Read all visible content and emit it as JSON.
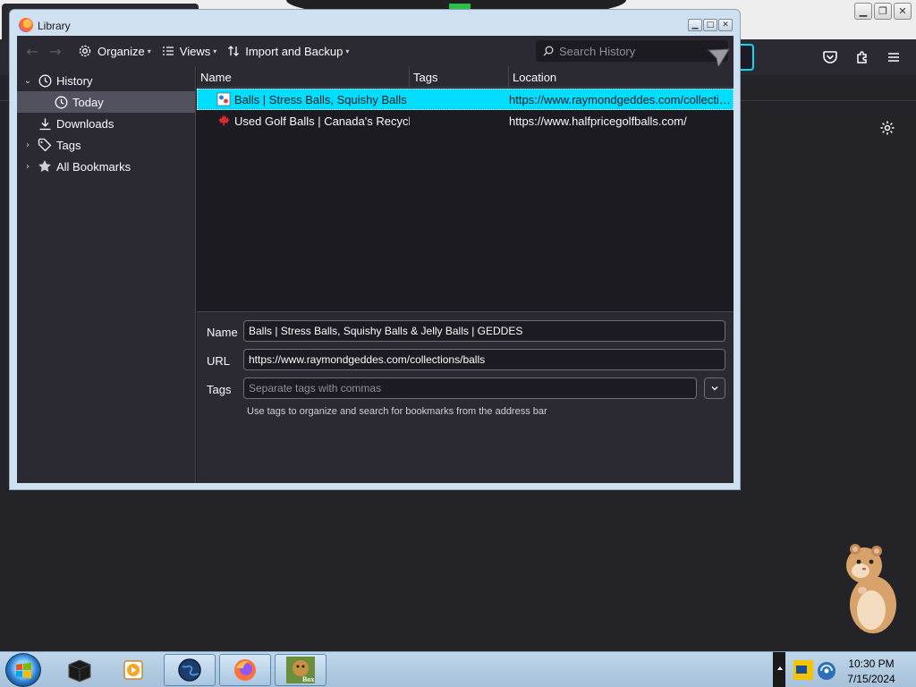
{
  "window": {
    "title": "Library"
  },
  "toolbar": {
    "back_icon": "back-arrow-icon",
    "forward_icon": "forward-arrow-icon",
    "organize_label": "Organize",
    "views_label": "Views",
    "import_label": "Import and Backup",
    "search_placeholder": "Search History"
  },
  "sidebar": {
    "items": [
      {
        "label": "History",
        "icon": "clock-icon",
        "expanded": true
      },
      {
        "label": "Today",
        "icon": "clock-icon",
        "selected": true
      },
      {
        "label": "Downloads",
        "icon": "download-icon"
      },
      {
        "label": "Tags",
        "icon": "tag-icon",
        "expanded": false
      },
      {
        "label": "All Bookmarks",
        "icon": "star-icon",
        "expanded": false
      }
    ]
  },
  "columns": {
    "name": "Name",
    "tags": "Tags",
    "location": "Location"
  },
  "rows": [
    {
      "name": "Balls | Stress Balls, Squishy Balls & ...",
      "tags": "",
      "location": "https://www.raymondgeddes.com/collectio...",
      "selected": true
    },
    {
      "name": "Used Golf Balls | Canada's Recycle...",
      "tags": "",
      "location": "https://www.halfpricegolfballs.com/",
      "selected": false
    }
  ],
  "details": {
    "name_label": "Name",
    "name_value": "Balls | Stress Balls, Squishy Balls & Jelly Balls | GEDDES",
    "url_label": "URL",
    "url_value": "https://www.raymondgeddes.com/collections/balls",
    "tags_label": "Tags",
    "tags_placeholder": "Separate tags with commas",
    "tags_hint": "Use tags to organize and search for bookmarks from the address bar"
  },
  "taskbar": {
    "time": "10:30 PM",
    "date": "7/15/2024",
    "box_label": "Box"
  },
  "colors": {
    "accent": "#00ddff",
    "window_bg": "#1c1b22",
    "panel_bg": "#2b2a33"
  }
}
